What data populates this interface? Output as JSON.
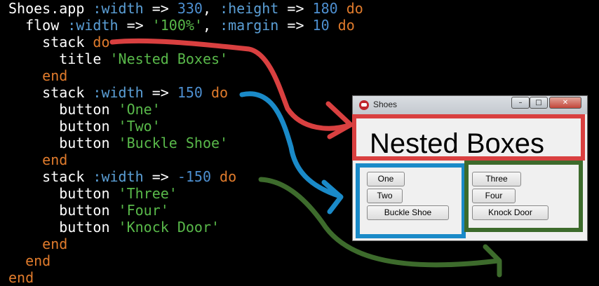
{
  "code_lines": [
    [
      {
        "t": "Shoes.app ",
        "c": "plain"
      },
      {
        "t": ":width",
        "c": "sym"
      },
      {
        "t": " => ",
        "c": "plain"
      },
      {
        "t": "330",
        "c": "num"
      },
      {
        "t": ", ",
        "c": "plain"
      },
      {
        "t": ":height",
        "c": "sym"
      },
      {
        "t": " => ",
        "c": "plain"
      },
      {
        "t": "180",
        "c": "num"
      },
      {
        "t": " do",
        "c": "kw"
      }
    ],
    [
      {
        "t": "  flow ",
        "c": "plain"
      },
      {
        "t": ":width",
        "c": "sym"
      },
      {
        "t": " => ",
        "c": "plain"
      },
      {
        "t": "'100%'",
        "c": "str"
      },
      {
        "t": ", ",
        "c": "plain"
      },
      {
        "t": ":margin",
        "c": "sym"
      },
      {
        "t": " => ",
        "c": "plain"
      },
      {
        "t": "10",
        "c": "num"
      },
      {
        "t": " do",
        "c": "kw"
      }
    ],
    [
      {
        "t": "    stack ",
        "c": "plain"
      },
      {
        "t": "do",
        "c": "kw"
      }
    ],
    [
      {
        "t": "      title ",
        "c": "plain"
      },
      {
        "t": "'Nested Boxes'",
        "c": "str"
      }
    ],
    [
      {
        "t": "    end",
        "c": "kw"
      }
    ],
    [
      {
        "t": "    stack ",
        "c": "plain"
      },
      {
        "t": ":width",
        "c": "sym"
      },
      {
        "t": " => ",
        "c": "plain"
      },
      {
        "t": "150",
        "c": "num"
      },
      {
        "t": " do",
        "c": "kw"
      }
    ],
    [
      {
        "t": "      button ",
        "c": "plain"
      },
      {
        "t": "'One'",
        "c": "str"
      }
    ],
    [
      {
        "t": "      button ",
        "c": "plain"
      },
      {
        "t": "'Two'",
        "c": "str"
      }
    ],
    [
      {
        "t": "      button ",
        "c": "plain"
      },
      {
        "t": "'Buckle Shoe'",
        "c": "str"
      }
    ],
    [
      {
        "t": "    end",
        "c": "kw"
      }
    ],
    [
      {
        "t": "    stack ",
        "c": "plain"
      },
      {
        "t": ":width",
        "c": "sym"
      },
      {
        "t": " => ",
        "c": "plain"
      },
      {
        "t": "-150",
        "c": "num"
      },
      {
        "t": " do",
        "c": "kw"
      }
    ],
    [
      {
        "t": "      button ",
        "c": "plain"
      },
      {
        "t": "'Three'",
        "c": "str"
      }
    ],
    [
      {
        "t": "      button ",
        "c": "plain"
      },
      {
        "t": "'Four'",
        "c": "str"
      }
    ],
    [
      {
        "t": "      button ",
        "c": "plain"
      },
      {
        "t": "'Knock Door'",
        "c": "str"
      }
    ],
    [
      {
        "t": "    end",
        "c": "kw"
      }
    ],
    [
      {
        "t": "  end",
        "c": "kw"
      }
    ],
    [
      {
        "t": "end",
        "c": "kw"
      }
    ]
  ],
  "window": {
    "title": "Shoes",
    "controls": {
      "minimize_icon": "minimize-icon",
      "maximize_icon": "maximize-icon",
      "close_icon": "close-icon"
    },
    "heading": "Nested Boxes",
    "left_stack_buttons": [
      "One",
      "Two",
      "Buckle Shoe"
    ],
    "right_stack_buttons": [
      "Three",
      "Four",
      "Knock Door"
    ]
  },
  "colors": {
    "background": "#000000",
    "keyword": "#e07b2c",
    "symbol": "#5b9fd6",
    "number": "#4d8fd0",
    "string": "#59b94a",
    "annotation_red": "#d94040",
    "annotation_blue": "#1a8ac8",
    "annotation_green": "#3d6b2c"
  }
}
